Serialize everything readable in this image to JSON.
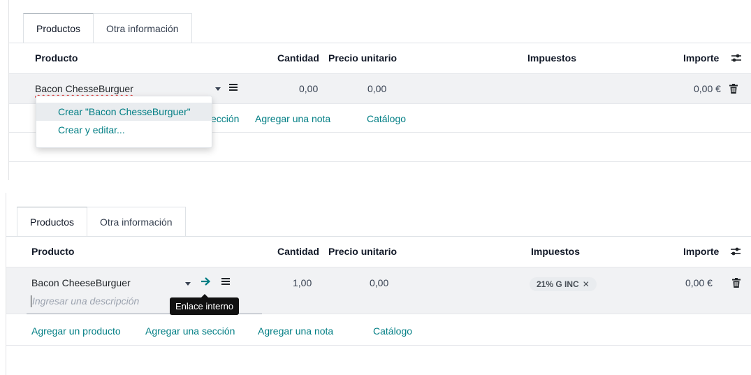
{
  "panel_a": {
    "tabs": [
      {
        "label": "Productos"
      },
      {
        "label": "Otra información"
      }
    ],
    "headers": {
      "producto": "Producto",
      "cantidad": "Cantidad",
      "precio": "Precio unitario",
      "impuestos": "Impuestos",
      "importe": "Importe"
    },
    "row": {
      "product_input": "Bacon ChesseBurguer",
      "cantidad": "0,00",
      "precio": "0,00",
      "importe": "0,00 €"
    },
    "dropdown": [
      {
        "label": "Crear \"Bacon ChesseBurguer\""
      },
      {
        "label": "Crear y editar..."
      }
    ],
    "actions": {
      "section_partial": "ección",
      "note": "Agregar una nota",
      "catalog": "Catálogo"
    }
  },
  "panel_b": {
    "tabs": [
      {
        "label": "Productos"
      },
      {
        "label": "Otra información"
      }
    ],
    "headers": {
      "producto": "Producto",
      "cantidad": "Cantidad",
      "precio": "Precio unitario",
      "impuestos": "Impuestos",
      "importe": "Importe"
    },
    "row": {
      "product": "Bacon CheeseBurguer",
      "description_placeholder": "Ingresar una descripción",
      "cantidad": "1,00",
      "precio": "0,00",
      "tax_badge": "21% G INC",
      "importe": "0,00 €"
    },
    "tooltip": "Enlace interno",
    "actions": {
      "add_product": "Agregar un producto",
      "add_section": "Agregar una sección",
      "add_note": "Agregar una nota",
      "catalog": "Catálogo"
    }
  },
  "icons": [
    "caret-down-icon",
    "hamburger-icon",
    "arrow-right-icon",
    "trash-icon",
    "sliders-icon",
    "close-icon"
  ],
  "colors": {
    "accent": "#017e84",
    "row_bg": "#f1f2f4"
  }
}
